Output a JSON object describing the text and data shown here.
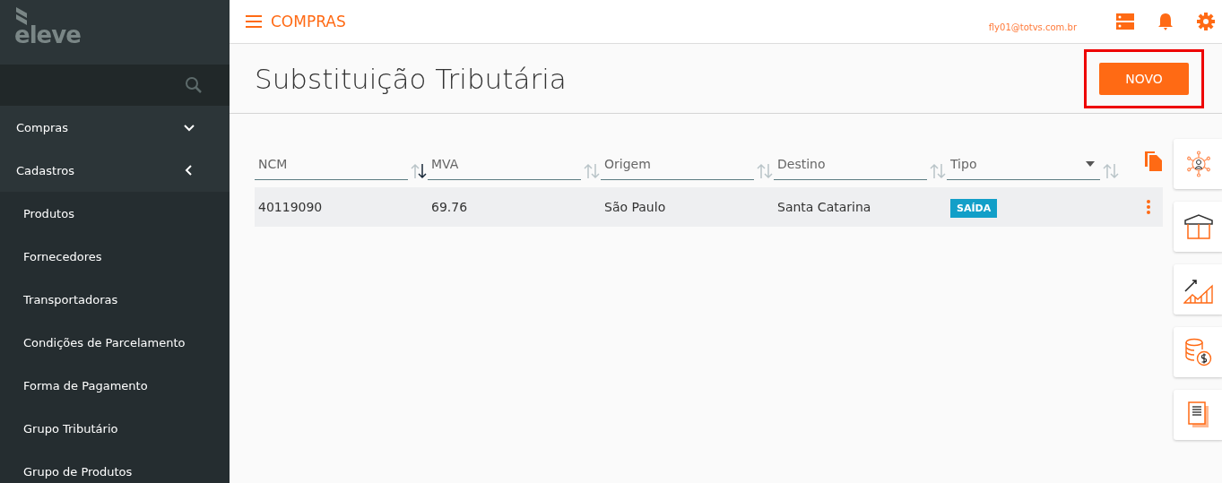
{
  "logo": {
    "text": "eleve"
  },
  "sidebar": {
    "items": [
      {
        "label": "Compras",
        "expanded": false
      },
      {
        "label": "Cadastros",
        "expanded": true,
        "children": [
          {
            "label": "Produtos"
          },
          {
            "label": "Fornecedores"
          },
          {
            "label": "Transportadoras"
          },
          {
            "label": "Condições de Parcelamento"
          },
          {
            "label": "Forma de Pagamento"
          },
          {
            "label": "Grupo Tributário"
          },
          {
            "label": "Grupo de Produtos"
          }
        ]
      }
    ]
  },
  "header": {
    "module": "COMPRAS",
    "user": "fly01@totvs.com.br"
  },
  "page": {
    "title": "Substituição Tributária",
    "new_button": {
      "label": "NOVO",
      "highlighted": true
    }
  },
  "table": {
    "columns": [
      {
        "label": "NCM",
        "kind": "text",
        "sorted": true
      },
      {
        "label": "MVA",
        "kind": "text",
        "sorted": false
      },
      {
        "label": "Origem",
        "kind": "text",
        "sorted": false
      },
      {
        "label": "Destino",
        "kind": "text",
        "sorted": false
      },
      {
        "label": "Tipo",
        "kind": "select",
        "sorted": false
      }
    ],
    "rows": [
      {
        "cells": [
          "40119090",
          "69.76",
          "São Paulo",
          "Santa Catarina"
        ],
        "badge": "SAÍDA"
      }
    ]
  }
}
